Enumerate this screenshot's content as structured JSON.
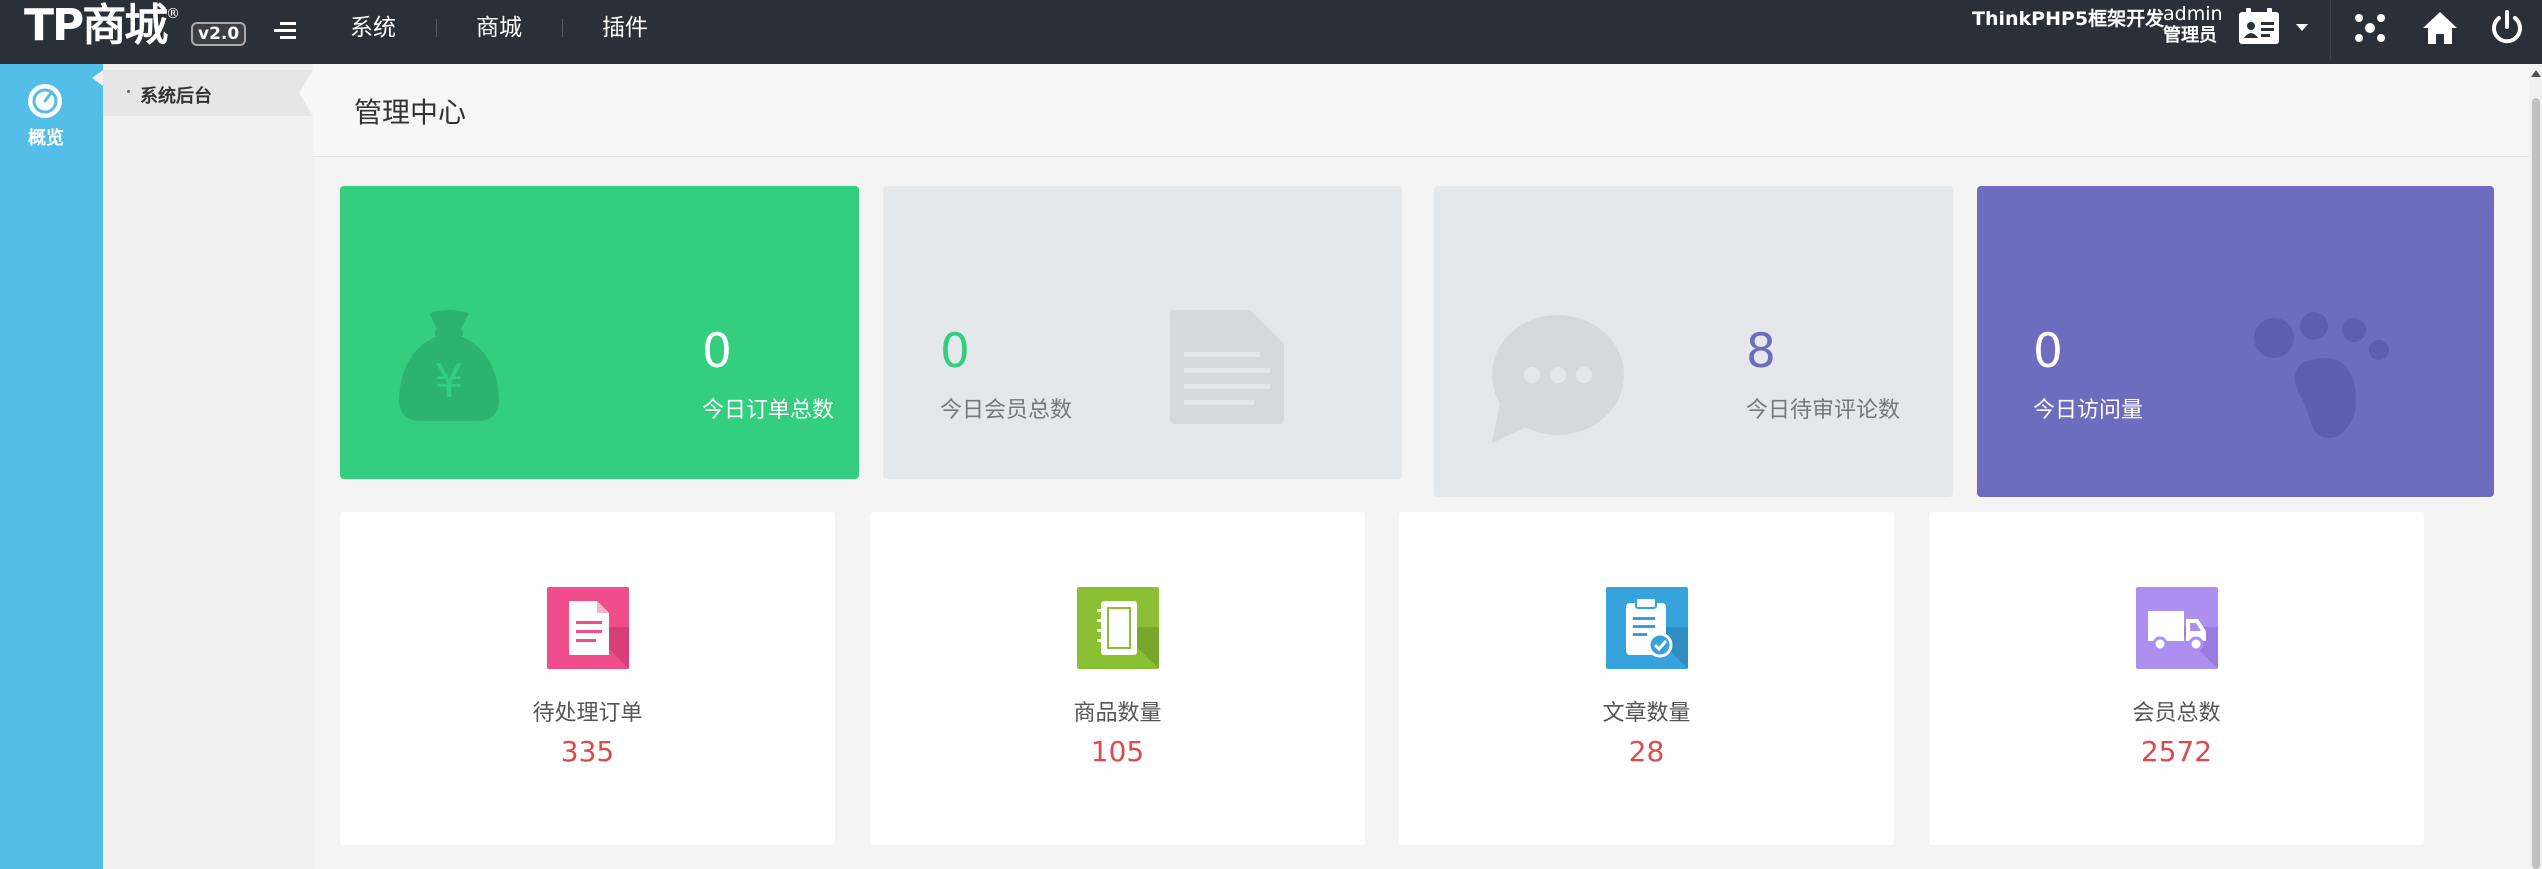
{
  "header": {
    "logo_text": "TP商城",
    "logo_mark": "®",
    "version": "v2.0",
    "nav": [
      {
        "label": "系统"
      },
      {
        "label": "商城"
      },
      {
        "label": "插件"
      }
    ],
    "brand_text": "ThinkPHP5框架开发",
    "user_name": "admin",
    "user_role": "管理员"
  },
  "rail": {
    "item_label": "概览"
  },
  "submenu": {
    "items": [
      {
        "label": "系统后台"
      }
    ]
  },
  "page": {
    "title": "管理中心"
  },
  "stats": [
    {
      "value": "0",
      "label": "今日订单总数",
      "color": "#34ce7f",
      "icon": "money-bag-icon"
    },
    {
      "value": "0",
      "label": "今日会员总数",
      "color": "#e4e8eb",
      "icon": "document-icon"
    },
    {
      "value": "8",
      "label": "今日待审评论数",
      "color": "#e4e8eb",
      "icon": "chat-bubble-icon"
    },
    {
      "value": "0",
      "label": "今日访问量",
      "color": "#6c6dbf",
      "icon": "footprint-icon"
    }
  ],
  "summary": [
    {
      "label": "待处理订单",
      "value": "335",
      "icon": "order-document-icon",
      "color": "#ef4d8b"
    },
    {
      "label": "商品数量",
      "value": "105",
      "icon": "notebook-icon",
      "color": "#8bc034"
    },
    {
      "label": "文章数量",
      "value": "28",
      "icon": "clipboard-check-icon",
      "color": "#36a3dd"
    },
    {
      "label": "会员总数",
      "value": "2572",
      "icon": "truck-icon",
      "color": "#ad8ff0"
    }
  ]
}
